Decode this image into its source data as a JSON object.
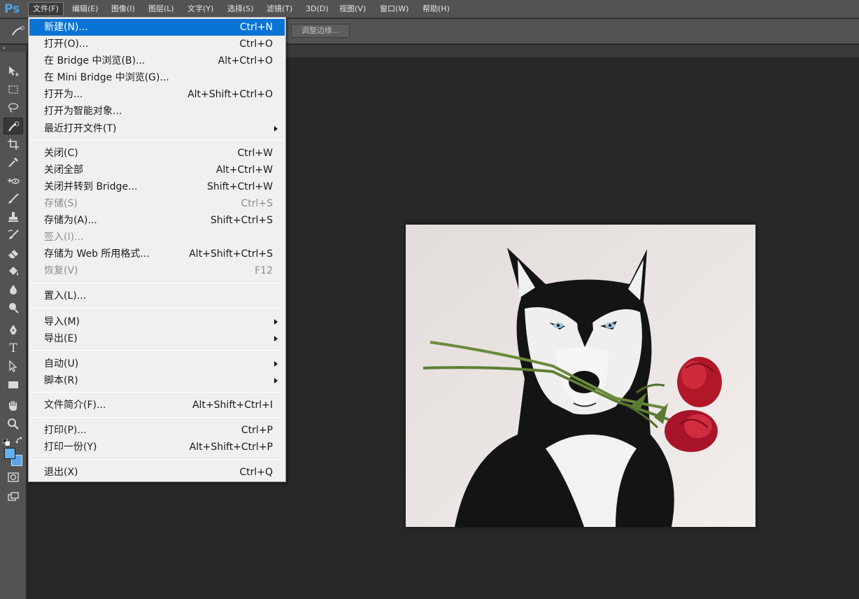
{
  "app": {
    "logo": "Ps"
  },
  "menubar": [
    {
      "label": "文件(F)",
      "open": true
    },
    {
      "label": "编辑(E)"
    },
    {
      "label": "图像(I)"
    },
    {
      "label": "图层(L)"
    },
    {
      "label": "文字(Y)"
    },
    {
      "label": "选择(S)"
    },
    {
      "label": "滤镜(T)"
    },
    {
      "label": "3D(D)"
    },
    {
      "label": "视图(V)"
    },
    {
      "label": "窗口(W)"
    },
    {
      "label": "帮助(H)"
    }
  ],
  "options_bar": {
    "refine_edge_label": "调整边缘..."
  },
  "toolbar": {
    "grip": "»",
    "tools": [
      {
        "name": "move-tool",
        "icon": "move-icon"
      },
      {
        "name": "marquee-tool",
        "icon": "rect-marquee-icon"
      },
      {
        "name": "lasso-tool",
        "icon": "lasso-icon"
      },
      {
        "name": "quick-selection-tool",
        "icon": "quick-selection-icon",
        "active": true
      },
      {
        "name": "crop-tool",
        "icon": "crop-icon"
      },
      {
        "name": "eyedropper-tool",
        "icon": "eyedropper-icon"
      },
      {
        "name": "healing-brush-tool",
        "icon": "healing-icon"
      },
      {
        "name": "brush-tool",
        "icon": "brush-icon"
      },
      {
        "name": "clone-stamp-tool",
        "icon": "stamp-icon"
      },
      {
        "name": "history-brush-tool",
        "icon": "history-brush-icon"
      },
      {
        "name": "eraser-tool",
        "icon": "eraser-icon"
      },
      {
        "name": "paint-bucket-tool",
        "icon": "bucket-icon"
      },
      {
        "name": "blur-tool",
        "icon": "drop-icon"
      },
      {
        "name": "dodge-tool",
        "icon": "dodge-icon"
      },
      {
        "name": "pen-tool",
        "icon": "pen-icon"
      },
      {
        "name": "type-tool",
        "icon": "type-icon",
        "glyph": "T"
      },
      {
        "name": "path-selection-tool",
        "icon": "arrow-icon"
      },
      {
        "name": "rectangle-tool",
        "icon": "rectangle-icon"
      },
      {
        "name": "hand-tool",
        "icon": "hand-icon"
      },
      {
        "name": "zoom-tool",
        "icon": "zoom-icon"
      }
    ],
    "foreground_color": "#63b0ef",
    "background_color": "#5aa6e8"
  },
  "file_menu": {
    "items": [
      {
        "label": "新建(N)...",
        "shortcut": "Ctrl+N",
        "highlight": true
      },
      {
        "label": "打开(O)...",
        "shortcut": "Ctrl+O"
      },
      {
        "label": "在 Bridge 中浏览(B)...",
        "shortcut": "Alt+Ctrl+O"
      },
      {
        "label": "在 Mini Bridge 中浏览(G)...",
        "shortcut": ""
      },
      {
        "label": "打开为...",
        "shortcut": "Alt+Shift+Ctrl+O"
      },
      {
        "label": "打开为智能对象...",
        "shortcut": ""
      },
      {
        "label": "最近打开文件(T)",
        "shortcut": "",
        "submenu": true
      },
      {
        "separator": true
      },
      {
        "label": "关闭(C)",
        "shortcut": "Ctrl+W"
      },
      {
        "label": "关闭全部",
        "shortcut": "Alt+Ctrl+W"
      },
      {
        "label": "关闭并转到 Bridge...",
        "shortcut": "Shift+Ctrl+W"
      },
      {
        "label": "存储(S)",
        "shortcut": "Ctrl+S",
        "disabled": true
      },
      {
        "label": "存储为(A)...",
        "shortcut": "Shift+Ctrl+S"
      },
      {
        "label": "签入(I)...",
        "shortcut": "",
        "disabled": true
      },
      {
        "label": "存储为 Web 所用格式...",
        "shortcut": "Alt+Shift+Ctrl+S"
      },
      {
        "label": "恢复(V)",
        "shortcut": "F12",
        "disabled": true
      },
      {
        "separator": true
      },
      {
        "label": "置入(L)...",
        "shortcut": ""
      },
      {
        "separator": true
      },
      {
        "label": "导入(M)",
        "shortcut": "",
        "submenu": true
      },
      {
        "label": "导出(E)",
        "shortcut": "",
        "submenu": true
      },
      {
        "separator": true
      },
      {
        "label": "自动(U)",
        "shortcut": "",
        "submenu": true
      },
      {
        "label": "脚本(R)",
        "shortcut": "",
        "submenu": true
      },
      {
        "separator": true
      },
      {
        "label": "文件简介(F)...",
        "shortcut": "Alt+Shift+Ctrl+I"
      },
      {
        "separator": true
      },
      {
        "label": "打印(P)...",
        "shortcut": "Ctrl+P"
      },
      {
        "label": "打印一份(Y)",
        "shortcut": "Alt+Shift+Ctrl+P"
      },
      {
        "separator": true
      },
      {
        "label": "退出(X)",
        "shortcut": "Ctrl+Q"
      }
    ]
  },
  "colors": {
    "highlight": "#0a74d4",
    "menu_bg": "#f0f0f0",
    "workspace_bg": "#282828",
    "chrome": "#535353"
  }
}
